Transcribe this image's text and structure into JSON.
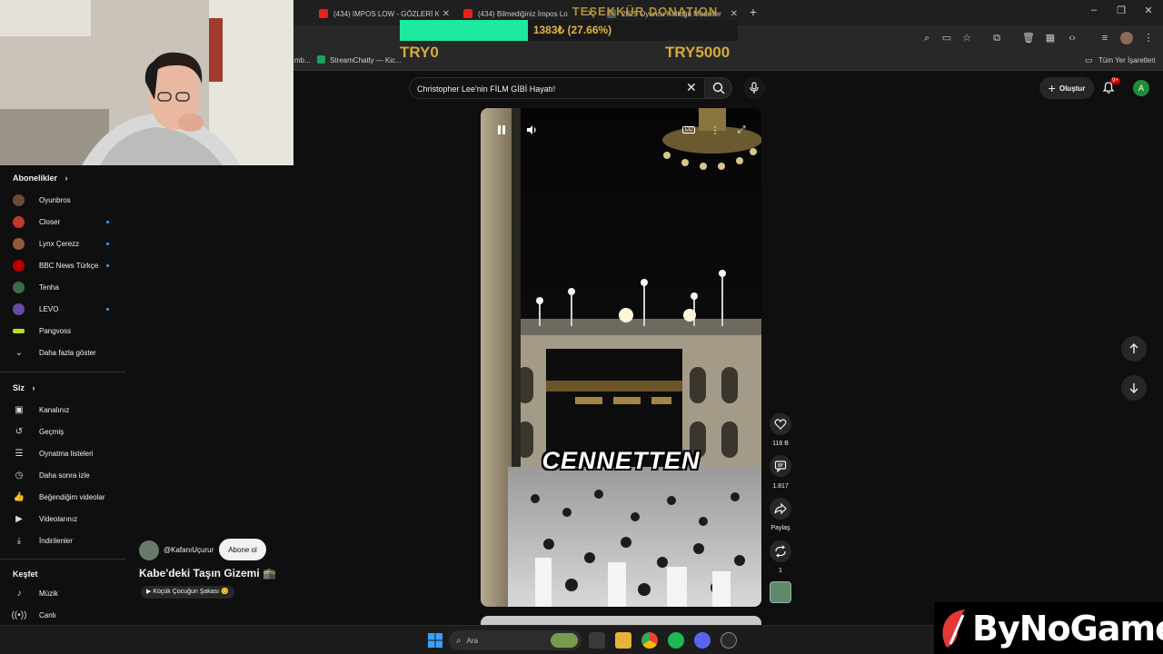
{
  "browser": {
    "tabs": [
      {
        "label": "(434) IMPOS LOW - GÖZLERİ K"
      },
      {
        "label": "(434) Bilmediğiniz İmpos Lo"
      },
      {
        "label": "2025 Oyuncu Koltuğu Modeller"
      }
    ],
    "bookmarks": [
      {
        "label": "mb..."
      },
      {
        "label": "StreamChatly — Kic..."
      }
    ],
    "all_bookmarks": "Tüm Yer İşaretleri"
  },
  "donation": {
    "title": "TEŞEKKÜR DONATION",
    "amount": "1383₺ (27.66%)",
    "progress": 0.2766,
    "min_label": "TRY0",
    "max_label": "TRY5000",
    "fill_color": "#1de9a0"
  },
  "sidebar": {
    "subscriptions_title": "Abonelikler",
    "subscriptions": [
      {
        "label": "Oyunbros",
        "color": "#6b4a3a",
        "new": false
      },
      {
        "label": "Closer",
        "color": "#c0392b",
        "new": true
      },
      {
        "label": "Lynx Çerezz",
        "color": "#8e5a3c",
        "new": true
      },
      {
        "label": "BBC News Türkçe",
        "color": "#b80000",
        "new": true
      },
      {
        "label": "Tenha",
        "color": "#3a6b4a",
        "new": false
      },
      {
        "label": "LEVO",
        "color": "#6a4aa0",
        "new": true
      },
      {
        "label": "Pangvoss",
        "color": "#c8d820",
        "new": false
      }
    ],
    "show_more": "Daha fazla göster",
    "you_title": "Siz",
    "you_items": [
      {
        "label": "Kanalınız",
        "icon": "user-square-icon"
      },
      {
        "label": "Geçmiş",
        "icon": "history-icon"
      },
      {
        "label": "Oynatma listeleri",
        "icon": "playlist-icon"
      },
      {
        "label": "Daha sonra izle",
        "icon": "clock-icon"
      },
      {
        "label": "Beğendiğim videolar",
        "icon": "thumbs-up-icon"
      },
      {
        "label": "Videolarınız",
        "icon": "video-icon"
      },
      {
        "label": "İndirilenler",
        "icon": "download-icon"
      }
    ],
    "explore_title": "Keşfet",
    "explore_items": [
      {
        "label": "Müzik",
        "icon": "music-note-icon"
      },
      {
        "label": "Canlı",
        "icon": "live-icon"
      }
    ]
  },
  "search": {
    "value": "Christopher Lee'nin FİLM GİBİ Hayatı!"
  },
  "header": {
    "create_label": "Oluştur",
    "notification_count": "9+",
    "account_initial": "A"
  },
  "short": {
    "caption": "CENNETTEN",
    "likes": "118 B",
    "comments": "1.817",
    "share_label": "Paylaş",
    "remix_count": "1",
    "channel": "@KafanıUçurur",
    "subscribe_label": "Abone ol",
    "title": "Kabe'deki Taşın Gizemi 🕋",
    "sound": "▶ Küçük Çocuğun Şakası 😊"
  },
  "taskbar": {
    "search_label": "Ara"
  },
  "watermark": {
    "text": "ByNoGame"
  }
}
